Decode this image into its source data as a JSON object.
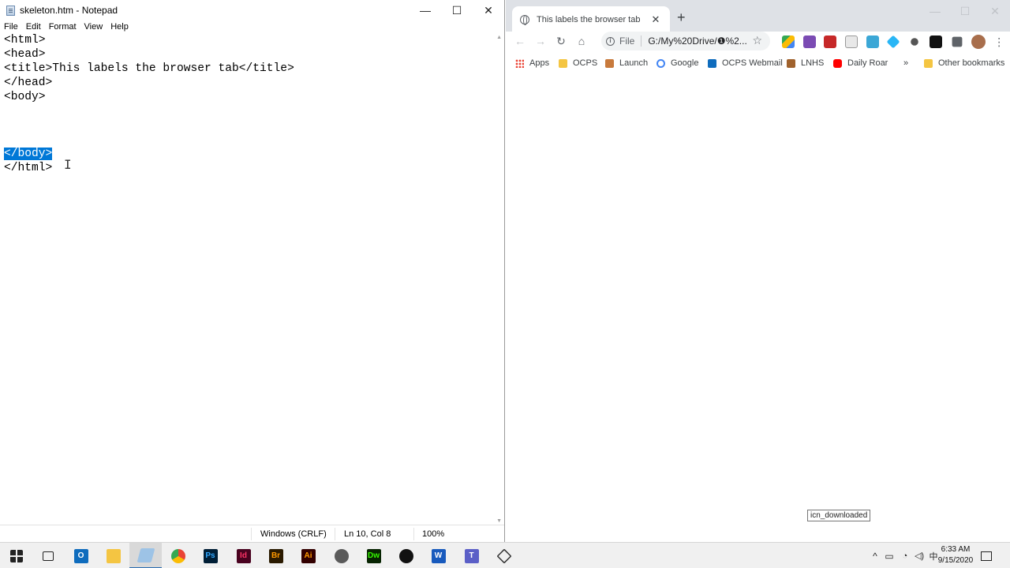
{
  "notepad": {
    "title": "skeleton.htm - Notepad",
    "window_buttons": {
      "minimize": "—",
      "maximize": "☐",
      "close": "✕"
    },
    "menu": [
      "File",
      "Edit",
      "Format",
      "View",
      "Help"
    ],
    "lines": [
      "<html>",
      "<head>",
      "<title>This labels the browser tab</title>",
      "</head>",
      "<body>",
      "",
      "",
      "",
      "</body>",
      "</html>"
    ],
    "selected_line_index": 8,
    "status": {
      "line_ending": "Windows (CRLF)",
      "position": "Ln 10, Col 8",
      "zoom": "100%"
    }
  },
  "chrome": {
    "tab_title": "This labels the browser tab",
    "tab_close": "✕",
    "new_tab": "+",
    "nav": {
      "back": "←",
      "forward": "→",
      "reload": "↻",
      "home": "⌂"
    },
    "omnibox": {
      "scheme_label": "File",
      "url": "G:/My%20Drive/❶%2..."
    },
    "bookmarks": [
      "Apps",
      "OCPS",
      "Launch",
      "Google",
      "OCPS Webmail",
      "LNHS",
      "Daily Roar",
      "»",
      "Other bookmarks"
    ],
    "tooltip": "icn_downloaded",
    "icons": {
      "bookmark": "star-icon",
      "site_info": "info-icon",
      "menu": "kebab-icon",
      "extensions": "puzzle-icon"
    }
  },
  "taskbar": {
    "apps": [
      "Start",
      "Task View",
      "Outlook",
      "File Explorer",
      "Notepad",
      "Chrome",
      "Photoshop",
      "InDesign",
      "Bridge",
      "Illustrator",
      "Settings",
      "Dreamweaver",
      "Xbox",
      "Word",
      "Teams",
      "App"
    ],
    "clock_time": "6:33 AM",
    "clock_date": "9/15/2020"
  },
  "colors": {
    "selection": "#0078d7",
    "chrome_tabbar": "#dee1e6",
    "taskbar": "#f0f0f0"
  }
}
